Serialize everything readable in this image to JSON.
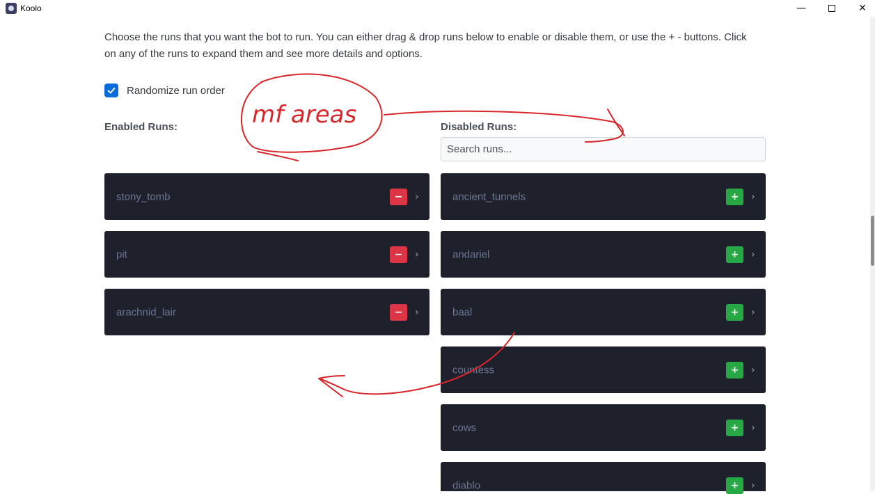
{
  "window": {
    "title": "Koolo",
    "minimize": "—",
    "close": "✕"
  },
  "intro": {
    "text": "Choose the runs that you want the bot to run. You can either drag & drop runs below to enable or disable them, or use the + - buttons. Click on any of the runs to expand them and see more details and options."
  },
  "randomize": {
    "label": "Randomize run order",
    "checked": true
  },
  "enabled": {
    "label": "Enabled Runs:",
    "runs": [
      {
        "name": "stony_tomb",
        "action": "−"
      },
      {
        "name": "pit",
        "action": "−"
      },
      {
        "name": "arachnid_lair",
        "action": "−"
      }
    ]
  },
  "disabled": {
    "label": "Disabled Runs:",
    "search_placeholder": "Search runs...",
    "runs": [
      {
        "name": "ancient_tunnels",
        "action": "+"
      },
      {
        "name": "andariel",
        "action": "+"
      },
      {
        "name": "baal",
        "action": "+"
      },
      {
        "name": "countess",
        "action": "+"
      },
      {
        "name": "cows",
        "action": "+"
      },
      {
        "name": "diablo",
        "action": "+"
      }
    ]
  },
  "chevron": "›",
  "annotation": {
    "text": "mf areas",
    "color": "#d9262b"
  }
}
